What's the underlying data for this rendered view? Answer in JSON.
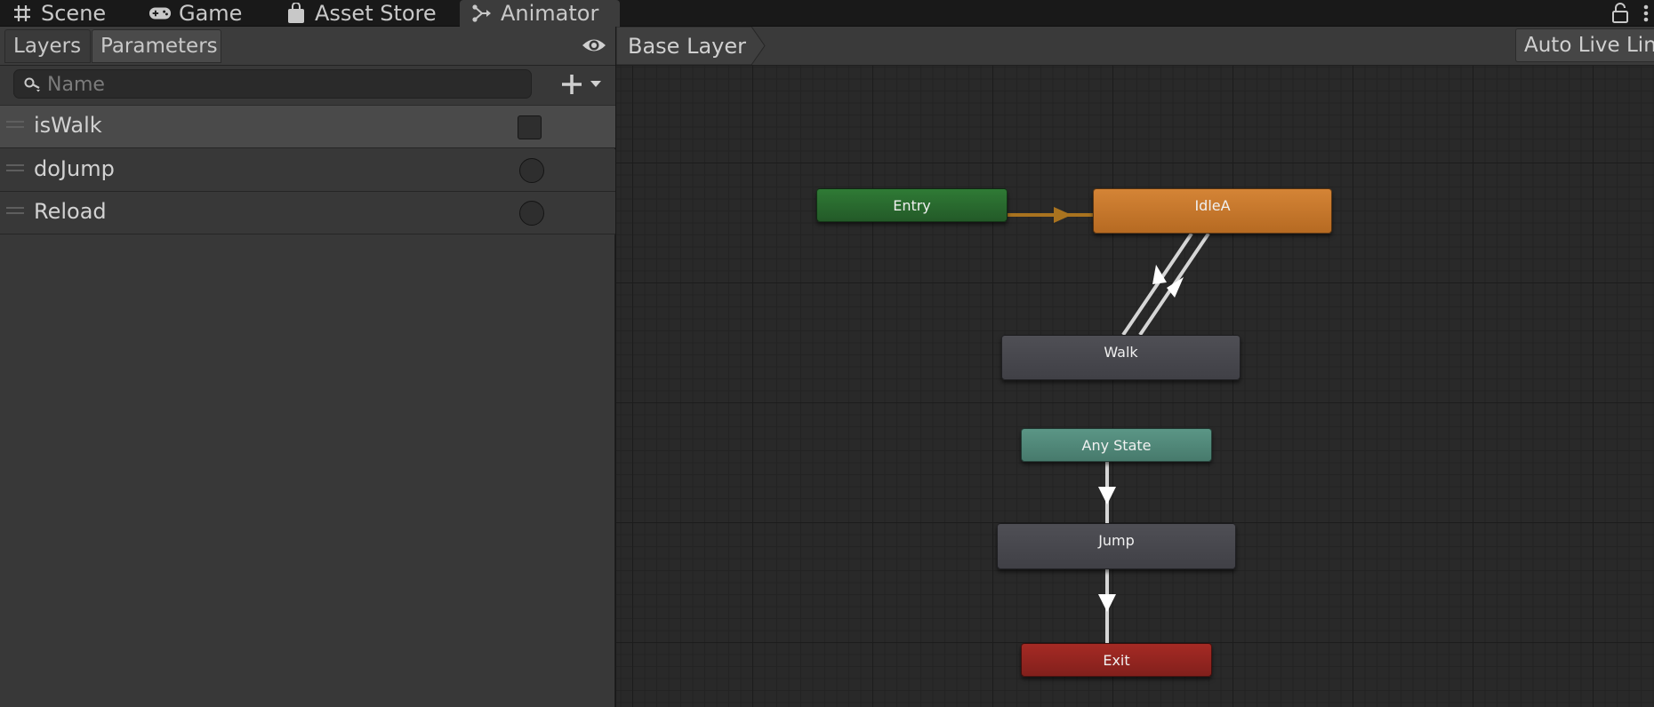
{
  "tabs": [
    {
      "label": "Scene",
      "icon": "grid-hash-icon"
    },
    {
      "label": "Game",
      "icon": "gamepad-icon"
    },
    {
      "label": "Asset Store",
      "icon": "shopping-bag-icon"
    },
    {
      "label": "Animator",
      "icon": "animator-icon",
      "active": true
    }
  ],
  "left_panel": {
    "subtabs": [
      "Layers",
      "Parameters"
    ],
    "active_subtab": "Parameters",
    "search": {
      "placeholder": "Name",
      "value": ""
    },
    "parameters": [
      {
        "name": "isWalk",
        "type": "bool",
        "selected": true
      },
      {
        "name": "doJump",
        "type": "trigger"
      },
      {
        "name": "Reload",
        "type": "trigger"
      }
    ]
  },
  "graph": {
    "breadcrumb": "Base Layer",
    "auto_live_link": "Auto Live Lin",
    "states": {
      "entry": "Entry",
      "idle": "IdleA",
      "walk": "Walk",
      "any_state": "Any State",
      "jump": "Jump",
      "exit": "Exit"
    }
  },
  "colors": {
    "entry": "#2f7a35",
    "default_state": "#d48436",
    "state": "#4a4a50",
    "any_state": "#5b9686",
    "exit": "#a52a24"
  }
}
